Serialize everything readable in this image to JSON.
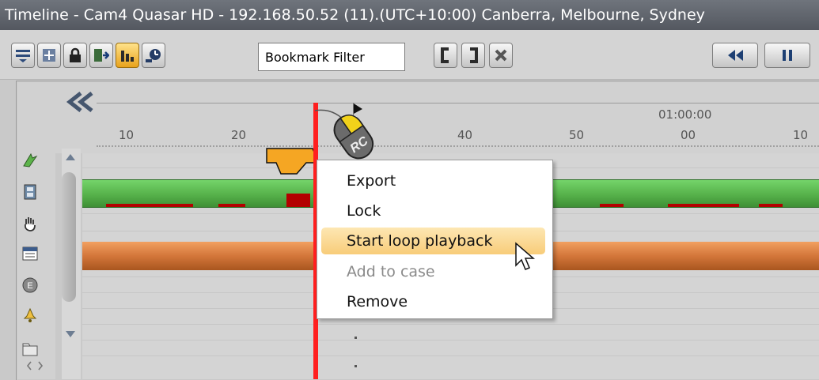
{
  "window": {
    "title": "Timeline - Cam4 Quasar HD - 192.168.50.52 (11).(UTC+10:00) Canberra, Melbourne, Sydney"
  },
  "toolbar": {
    "buttons": [
      {
        "name": "filter-list-icon"
      },
      {
        "name": "sequence-icon"
      },
      {
        "name": "lock-icon"
      },
      {
        "name": "export-icon"
      },
      {
        "name": "bar-chart-icon",
        "active": true
      },
      {
        "name": "search-motion-icon"
      }
    ],
    "bookmark_filter": "Bookmark Filter",
    "mark_in_icon": "bracket-left-icon",
    "mark_out_icon": "bracket-right-icon",
    "clear_marks_icon": "x-icon",
    "rewind_icon": "rewind-icon",
    "pause_icon": "pause-icon"
  },
  "ruler": {
    "time_label": "01:00:00",
    "ticks": [
      "10",
      "20",
      "40",
      "50",
      "00",
      "10"
    ]
  },
  "context_menu": {
    "items": [
      {
        "label": "Export",
        "state": "normal"
      },
      {
        "label": "Lock",
        "state": "normal"
      },
      {
        "label": "Start loop playback",
        "state": "highlighted"
      },
      {
        "label": "Add to case",
        "state": "disabled"
      },
      {
        "label": "Remove",
        "state": "normal"
      }
    ]
  },
  "colors": {
    "title_bar": "#5f636b",
    "playhead": "#ff1f1f",
    "recording_track": "#56b14a",
    "second_track": "#d3763a",
    "bookmark_marker": "#f5a623",
    "menu_highlight": "#f8cc79"
  }
}
